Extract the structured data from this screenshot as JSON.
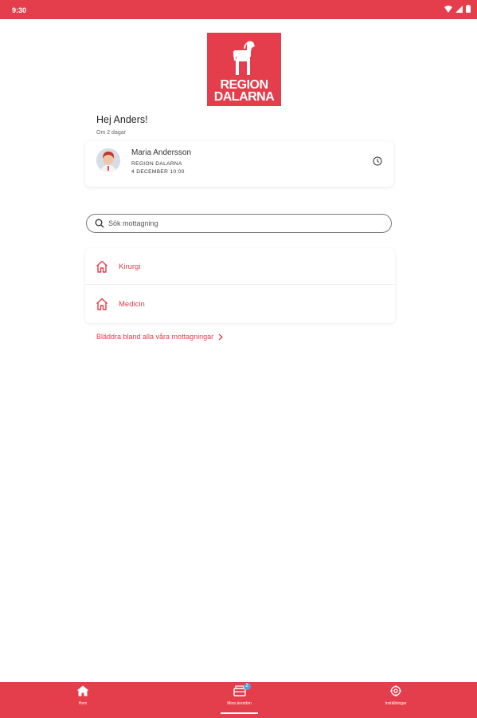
{
  "status_bar": {
    "time": "9:30"
  },
  "logo": {
    "line1": "REGION",
    "line2": "DALARNA"
  },
  "greeting": {
    "title": "Hej Anders!",
    "subtitle": "Om 2 dagar"
  },
  "appointment": {
    "name": "Maria Andersson",
    "organization": "REGION DALARNA",
    "datetime": "4 DECEMBER 10:00"
  },
  "search": {
    "placeholder": "Sök mottagning"
  },
  "departments": [
    {
      "label": "Kirurgi"
    },
    {
      "label": "Medicin"
    }
  ],
  "browse_link": "Bläddra bland alla våra mottagningar",
  "bottom_nav": {
    "items": [
      {
        "label": "Hem",
        "icon": "home-icon"
      },
      {
        "label": "Mina ärenden",
        "icon": "cases-icon",
        "badge": "2"
      },
      {
        "label": "Inställningar",
        "icon": "settings-icon"
      }
    ]
  },
  "colors": {
    "brand": "#e43d4b",
    "badge": "#5aa0d8"
  }
}
